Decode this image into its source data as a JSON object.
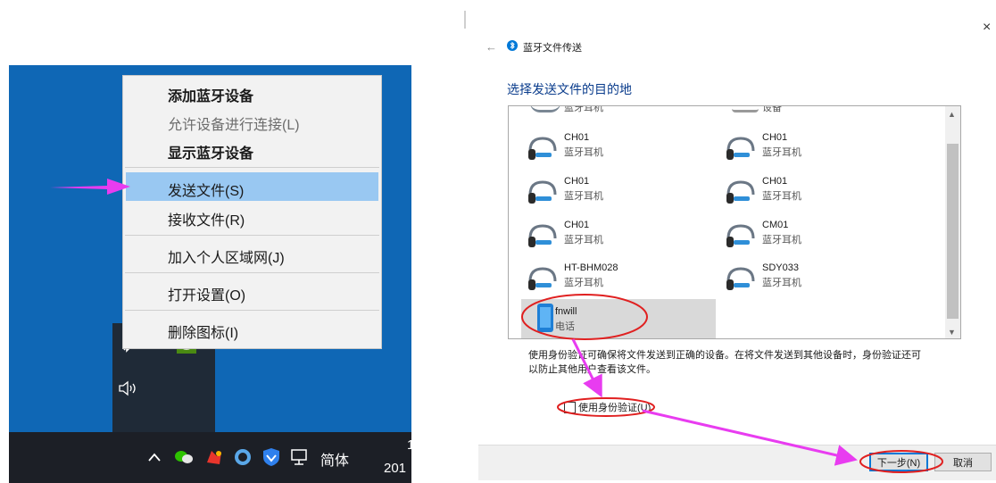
{
  "context_menu": {
    "items": [
      {
        "label": "添加蓝牙设备"
      },
      {
        "label": "允许设备进行连接(L)"
      },
      {
        "label": "显示蓝牙设备"
      },
      {
        "label": "发送文件(S)"
      },
      {
        "label": "接收文件(R)"
      },
      {
        "label": "加入个人区域网(J)"
      },
      {
        "label": "打开设置(O)"
      },
      {
        "label": "删除图标(I)"
      }
    ]
  },
  "taskbar": {
    "ime_label": "简体",
    "clock_partial": "201",
    "clock_top_partial": "1"
  },
  "dialog": {
    "title": "蓝牙文件传送",
    "heading": "选择发送文件的目的地",
    "partial_top": [
      "蓝牙耳机",
      "设备"
    ],
    "devices": [
      {
        "name": "CH01",
        "type": "蓝牙耳机"
      },
      {
        "name": "CH01",
        "type": "蓝牙耳机"
      },
      {
        "name": "CH01",
        "type": "蓝牙耳机"
      },
      {
        "name": "CH01",
        "type": "蓝牙耳机"
      },
      {
        "name": "CH01",
        "type": "蓝牙耳机"
      },
      {
        "name": "CM01",
        "type": "蓝牙耳机"
      },
      {
        "name": "HT-BHM028",
        "type": "蓝牙耳机"
      },
      {
        "name": "SDY033",
        "type": "蓝牙耳机"
      },
      {
        "name": "fnwill",
        "type": "电话"
      }
    ],
    "note": "使用身份验证可确保将文件发送到正确的设备。在将文件发送到其他设备时，身份验证还可以防止其他用户查看该文件。",
    "auth_checkbox": {
      "label": "使用身份验证(U)",
      "checked": false
    },
    "buttons": {
      "next": "下一步(N)",
      "cancel": "取消"
    },
    "close_glyph": "×",
    "back_glyph": "←"
  },
  "colors": {
    "desktop": "#0f67b5",
    "menu_highlight": "#99c8f2",
    "annotation": "#e83cf0",
    "annotation_circle": "#e02020",
    "heading": "#0a3c8c"
  }
}
